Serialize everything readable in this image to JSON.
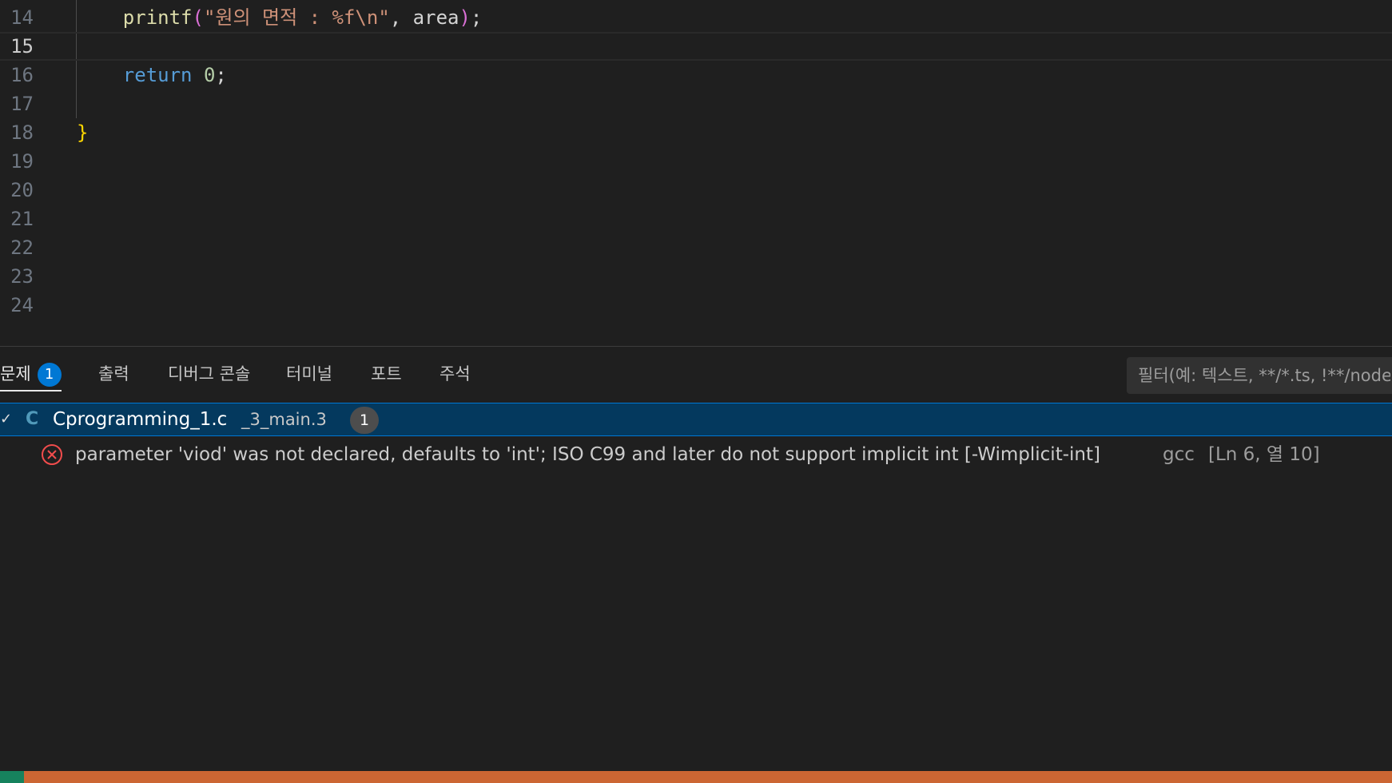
{
  "editor": {
    "lines": [
      {
        "n": "14"
      },
      {
        "n": "15"
      },
      {
        "n": "16"
      },
      {
        "n": "17"
      },
      {
        "n": "18"
      },
      {
        "n": "19"
      },
      {
        "n": "20"
      },
      {
        "n": "21"
      },
      {
        "n": "22"
      },
      {
        "n": "23"
      },
      {
        "n": "24"
      }
    ],
    "code14": {
      "indent": "    ",
      "func": "printf",
      "open": "(",
      "str": "\"원의 면적 : %f\\n\"",
      "rest": ", area",
      "close": ")",
      "end": ";"
    },
    "code16": {
      "indent": "    ",
      "kw": "return",
      "sp": " ",
      "num": "0",
      "end": ";"
    },
    "code18": {
      "brace": "}"
    }
  },
  "panel": {
    "tabs": {
      "problems": "문제",
      "problems_count": "1",
      "output": "출력",
      "debug_console": "디버그 콘솔",
      "terminal": "터미널",
      "ports": "포트",
      "comments": "주석"
    },
    "filter_placeholder": "필터(예: 텍스트, **/*.ts, !**/node_modules/**)",
    "file": {
      "chevron": "✓",
      "lang_icon": "C",
      "name": "Cprogramming_1.c",
      "path": "_3_main.3",
      "count": "1"
    },
    "problem": {
      "message": "parameter 'viod' was not declared, defaults to 'int'; ISO C99 and later do not support implicit int [-Wimplicit-int]",
      "source": "gcc",
      "location": "[Ln 6, 열 10]"
    }
  },
  "colors": {
    "accent": "#0078d4",
    "error": "#f14c4c",
    "statusbar": "#cc6633"
  }
}
